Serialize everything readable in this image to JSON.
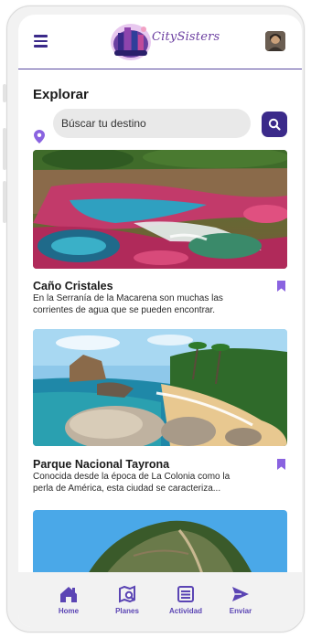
{
  "header": {
    "logo_text": "CitySisters",
    "menu_icon": "hamburger-menu-icon",
    "avatar": "user-avatar"
  },
  "explore": {
    "title": "Explorar",
    "search_placeholder": "Búscar tu destino",
    "search_icon": "search-icon",
    "location_icon": "location-pin-icon"
  },
  "places": [
    {
      "title": "Caño Cristales",
      "description": "En la Serranía de la Macarena son muchas las corrientes de agua que se pueden encontrar.",
      "icon": "bookmark-icon"
    },
    {
      "title": "Parque Nacional Tayrona",
      "description": "Conocida desde la época de La Colonia como la perla de América, esta ciudad se caracteriza...",
      "icon": "bookmark-icon"
    },
    {
      "title": "",
      "description": ""
    }
  ],
  "nav": [
    {
      "label": "Home",
      "icon": "home-icon"
    },
    {
      "label": "Planes",
      "icon": "map-search-icon"
    },
    {
      "label": "Actividad",
      "icon": "activity-list-icon"
    },
    {
      "label": "Enviar",
      "icon": "send-icon"
    }
  ],
  "colors": {
    "primary": "#3b2a8a",
    "accent": "#5b45b4",
    "bookmark": "#8a63e0",
    "search_bg": "#e9e9e9"
  }
}
